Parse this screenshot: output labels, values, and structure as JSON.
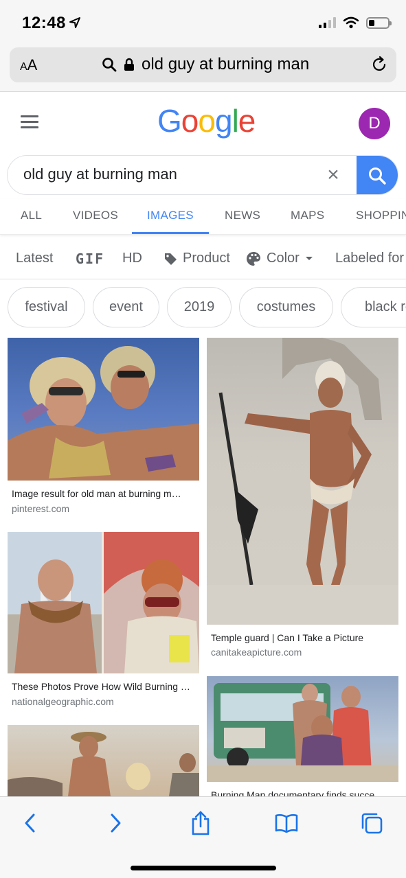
{
  "status_bar": {
    "time": "12:48"
  },
  "url_bar": {
    "aa_label_small": "A",
    "aa_label_large": "A",
    "url_text": "old guy at burning man"
  },
  "google": {
    "logo": [
      "G",
      "o",
      "o",
      "g",
      "l",
      "e"
    ],
    "logo_colors": [
      "#4285f4",
      "#ea4335",
      "#fbbc05",
      "#4285f4",
      "#34a853",
      "#ea4335"
    ],
    "avatar_letter": "D",
    "avatar_color": "#9c27b0"
  },
  "search": {
    "value": "old guy at burning man",
    "clear_label": "×"
  },
  "tabs": [
    {
      "label": "ALL",
      "active": false
    },
    {
      "label": "VIDEOS",
      "active": false
    },
    {
      "label": "IMAGES",
      "active": true
    },
    {
      "label": "NEWS",
      "active": false
    },
    {
      "label": "MAPS",
      "active": false
    },
    {
      "label": "SHOPPIN",
      "active": false
    }
  ],
  "filters": {
    "latest": "Latest",
    "gif": "GIF",
    "hd": "HD",
    "product": "Product",
    "color": "Color",
    "labeled": "Labeled for"
  },
  "chips": [
    "festival",
    "event",
    "2019",
    "costumes",
    "black ro"
  ],
  "results": [
    {
      "title": "Image result for old man at burning m…",
      "source": "pinterest.com"
    },
    {
      "title": "Temple guard | Can I Take a Picture",
      "source": "canitakeapicture.com"
    },
    {
      "title": "These Photos Prove How Wild Burning …",
      "source": "nationalgeographic.com"
    },
    {
      "title": "Burning Man documentary finds succe",
      "source": ""
    }
  ],
  "accent_color": "#4285f4",
  "toolbar_icons": [
    "back-icon",
    "forward-icon",
    "share-icon",
    "bookmarks-icon",
    "tabs-icon"
  ]
}
